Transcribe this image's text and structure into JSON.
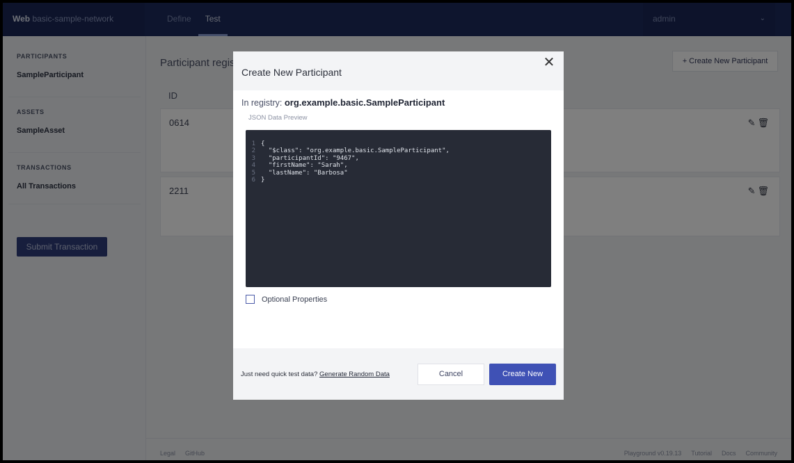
{
  "topnav": {
    "brand_bold": "Web",
    "brand_rest": " basic-sample-network",
    "tabs": [
      {
        "label": "Define"
      },
      {
        "label": "Test"
      }
    ],
    "user": "admin",
    "chevron": "⌄"
  },
  "sidebar": {
    "participants_heading": "PARTICIPANTS",
    "participant_item": "SampleParticipant",
    "assets_heading": "ASSETS",
    "asset_item": "SampleAsset",
    "transactions_heading": "TRANSACTIONS",
    "transaction_item": "All Transactions",
    "submit_label": "Submit Transaction"
  },
  "main": {
    "title": "Participant registry for org.example.basic.SampleParticipant",
    "create_label": "+ Create New Participant",
    "id_header": "ID",
    "rows": [
      {
        "id": "0614"
      },
      {
        "id": "2211"
      }
    ],
    "edit_icon": "✎",
    "delete_icon": "🗑"
  },
  "footer": {
    "left": [
      "Legal",
      "GitHub"
    ],
    "right": [
      "Playground v0.19.13",
      "Tutorial",
      "Docs",
      "Community"
    ]
  },
  "modal": {
    "title": "Create New Participant",
    "close_icon": "✕",
    "registry_prefix": "In registry: ",
    "registry_name": "org.example.basic.SampleParticipant",
    "preview_label": "JSON Data Preview",
    "code_lines": [
      {
        "num": "1",
        "text": "{"
      },
      {
        "num": "2",
        "text": "  \"$class\": \"org.example.basic.SampleParticipant\","
      },
      {
        "num": "3",
        "text": "  \"participantId\": \"9467\","
      },
      {
        "num": "4",
        "text": "  \"firstName\": \"Sarah\","
      },
      {
        "num": "5",
        "text": "  \"lastName\": \"Barbosa\""
      },
      {
        "num": "6",
        "text": "}"
      }
    ],
    "optional_label": "Optional Properties",
    "quick_prefix": "Just need quick test data? ",
    "quick_link": "Generate Random Data",
    "cancel_label": "Cancel",
    "create_label": "Create New"
  }
}
